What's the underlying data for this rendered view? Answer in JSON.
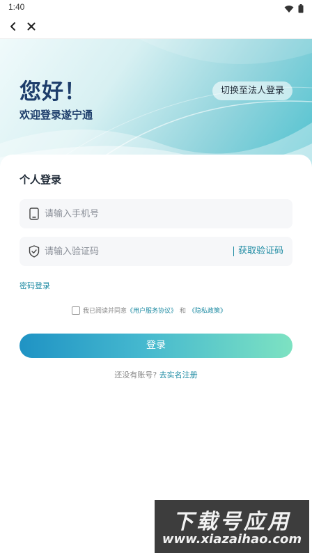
{
  "status_bar": {
    "time": "1:40",
    "icons": [
      "wifi-icon",
      "battery-icon"
    ]
  },
  "nav": {
    "back_icon": "chevron-left-icon",
    "close_icon": "close-icon"
  },
  "hero": {
    "title": "您好！",
    "subtitle": "欢迎登录遂宁通",
    "switch_label": "切换至法人登录"
  },
  "form": {
    "section_title": "个人登录",
    "phone": {
      "placeholder": "请输入手机号",
      "value": "",
      "icon": "phone-icon"
    },
    "code": {
      "placeholder": "请输入验证码",
      "value": "",
      "icon": "shield-check-icon",
      "get_code_label": "获取验证码"
    },
    "password_login_label": "密码登录",
    "agreement": {
      "prefix": "我已阅读并同意",
      "terms_link": "《用户服务协议》",
      "conjunction": "和",
      "privacy_link": "《隐私政策》",
      "checked": false
    },
    "login_label": "登录",
    "register_prefix": "还没有账号?",
    "register_link": "去实名注册"
  },
  "watermark": {
    "title": "下载号应用",
    "url": "www.xiazaihao.com"
  },
  "colors": {
    "accent": "#1e8ba3",
    "title": "#1d3d6b",
    "button_start": "#1f93c4",
    "button_end": "#7de2c2"
  }
}
